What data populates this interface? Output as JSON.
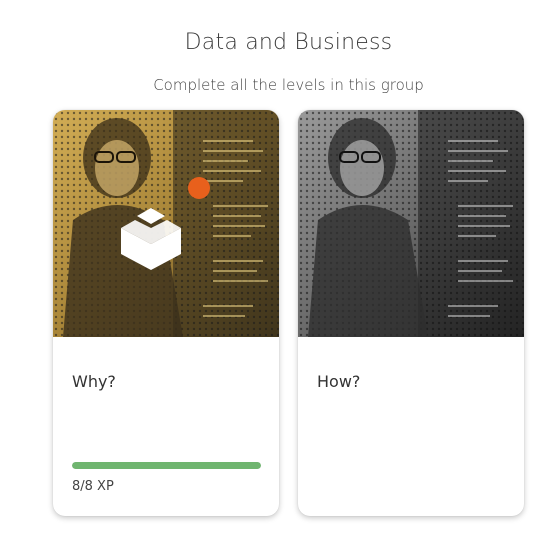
{
  "header": {
    "title": "Data and Business",
    "subtitle": "Complete all the levels in this group"
  },
  "cards": [
    {
      "label": "Why?",
      "xp_text": "8/8 XP",
      "progress": 1.0,
      "status": "completed",
      "image_icon": "completed-cube-icon",
      "accent_color": "#e8601c",
      "progress_color": "#6fb56f",
      "image_tint": "#caa24a"
    },
    {
      "label": "How?",
      "status": "locked",
      "image_tint": "#8a8a8a"
    }
  ]
}
